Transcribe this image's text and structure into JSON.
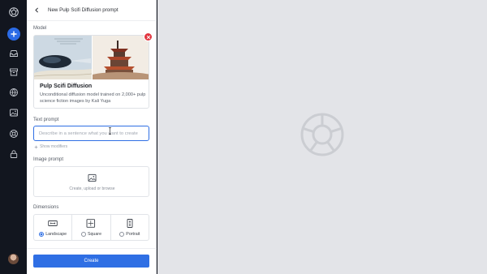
{
  "header": {
    "title": "New Pulp Scifi Diffusion prompt"
  },
  "model": {
    "section_label": "Model",
    "name": "Pulp Scifi Diffusion",
    "description": "Unconditional diffusion model trained on 2,000+ pulp science fiction images by Kali Yuga"
  },
  "text_prompt": {
    "label": "Text prompt",
    "placeholder": "Describe in a sentence what you want to create",
    "value": "",
    "modifiers_label": "Show modifiers"
  },
  "image_prompt": {
    "label": "Image prompt",
    "upload_label": "Create, upload or browse"
  },
  "dimensions": {
    "label": "Dimensions",
    "options": [
      {
        "label": "Landscape",
        "selected": true,
        "icon": "landscape-icon"
      },
      {
        "label": "Square",
        "selected": false,
        "icon": "square-icon"
      },
      {
        "label": "Portrait",
        "selected": false,
        "icon": "portrait-icon"
      }
    ]
  },
  "actions": {
    "create_label": "Create"
  },
  "colors": {
    "accent": "#2f6fe4",
    "danger": "#e2353f",
    "rail": "#12161f",
    "canvas": "#e3e4e8"
  },
  "rail_icons": [
    "logo-icon",
    "plus-icon",
    "inbox-icon",
    "archive-icon",
    "globe-icon",
    "image-icon",
    "lifebuoy-icon",
    "lock-icon",
    "avatar"
  ]
}
